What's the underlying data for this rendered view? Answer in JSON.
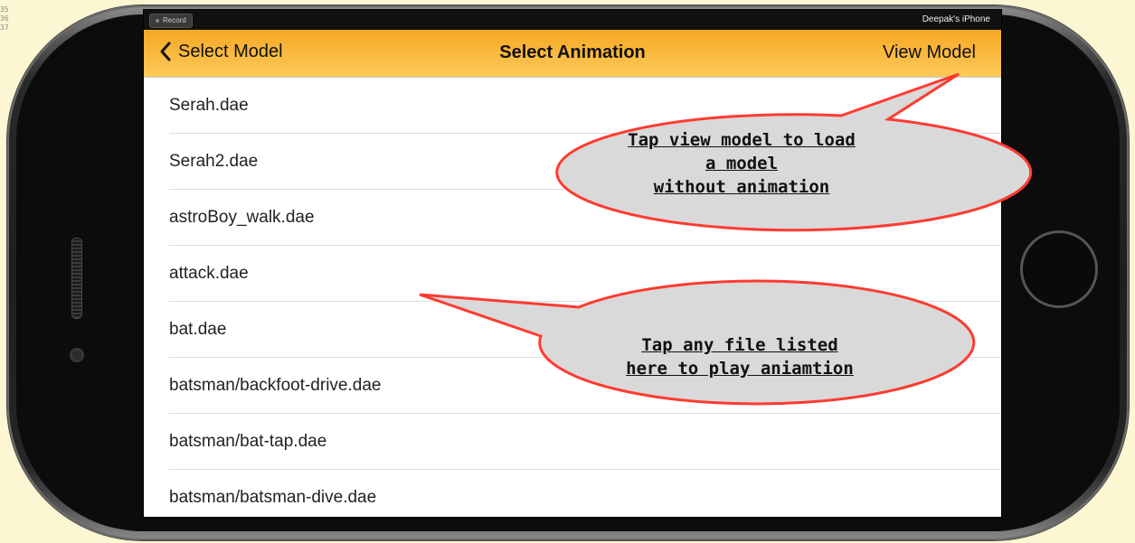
{
  "gutter": [
    "35",
    "36",
    "37"
  ],
  "statusbar": {
    "record_label": "Record",
    "device_name": "Deepak's iPhone"
  },
  "navbar": {
    "back_label": "Select Model",
    "title": "Select Animation",
    "right_label": "View Model"
  },
  "files": [
    "Serah.dae",
    "Serah2.dae",
    "astroBoy_walk.dae",
    "attack.dae",
    "bat.dae",
    "batsman/backfoot-drive.dae",
    "batsman/bat-tap.dae",
    "batsman/batsman-dive.dae"
  ],
  "callouts": {
    "view_model": [
      "Tap view model to load",
      "a model",
      "without animation"
    ],
    "files": [
      "Tap any file listed",
      "here to play aniamtion"
    ]
  },
  "colors": {
    "navbar_top": "#f7a823",
    "navbar_bottom": "#fcc95a",
    "callout_fill": "#d9d9d9",
    "callout_stroke": "#ff3b30"
  }
}
